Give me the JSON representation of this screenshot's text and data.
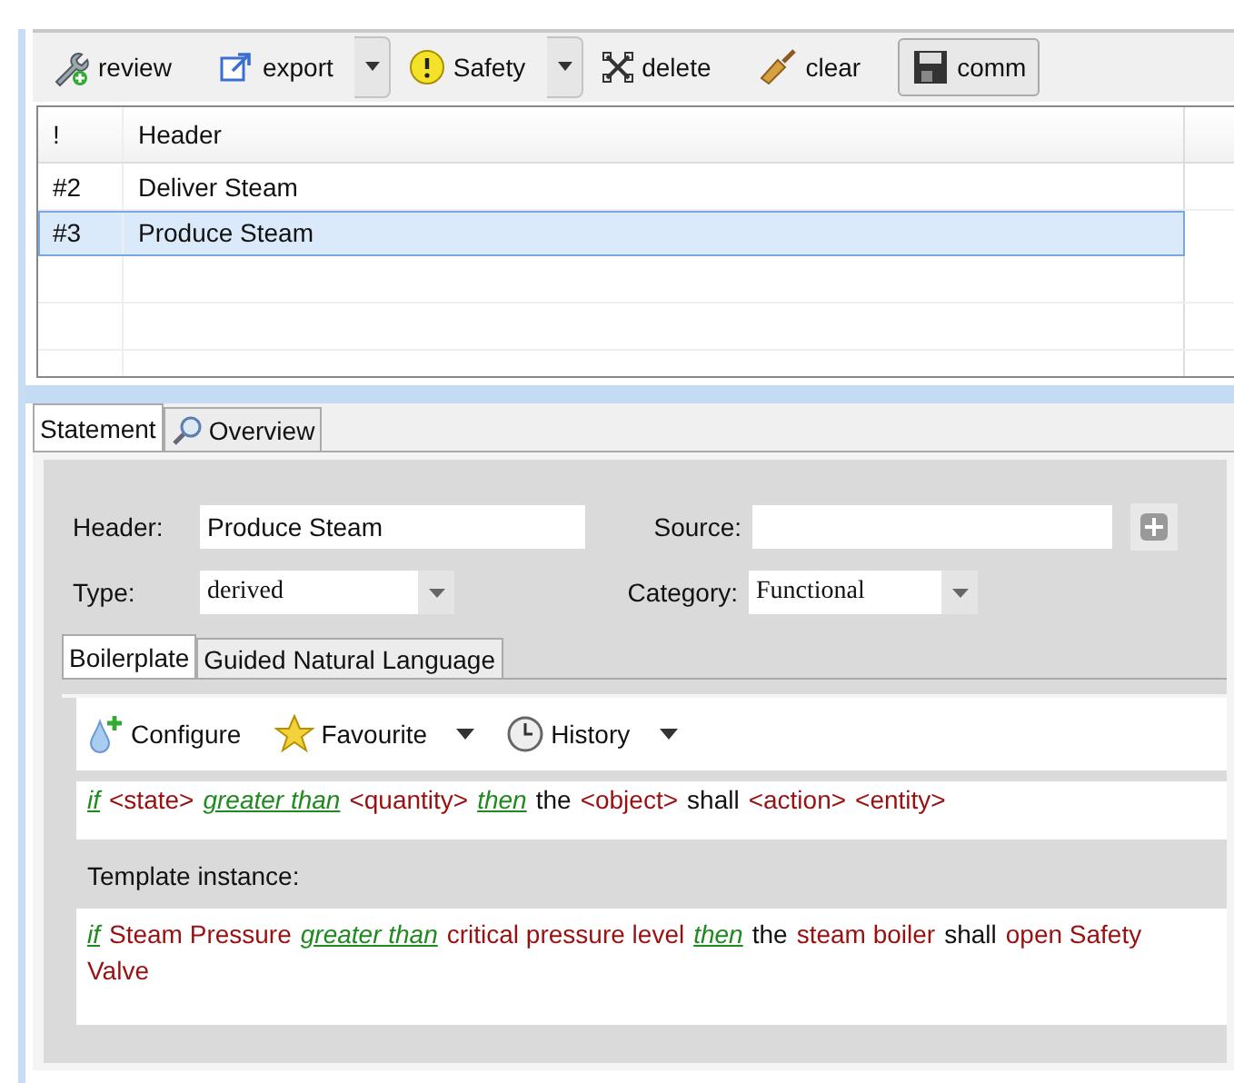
{
  "toolbar": [
    {
      "kind": "button",
      "label": "review"
    },
    {
      "kind": "button",
      "label": "export"
    },
    {
      "kind": "dropdown"
    },
    {
      "kind": "button",
      "label": "Safety"
    },
    {
      "kind": "dropdown"
    },
    {
      "kind": "button",
      "label": "delete"
    },
    {
      "kind": "button",
      "label": "clear"
    },
    {
      "kind": "framed",
      "label": "comm"
    }
  ],
  "table": {
    "columns": [
      "!",
      "Header"
    ],
    "rows": [
      {
        "id": "#2",
        "header": "Deliver Steam",
        "selected": false
      },
      {
        "id": "#3",
        "header": "Produce Steam",
        "selected": true
      }
    ]
  },
  "tabs": [
    {
      "label": "Statement",
      "selected": true
    },
    {
      "label": "Overview",
      "selected": false
    }
  ],
  "form": {
    "header_label": "Header:",
    "header_value": "Produce Steam",
    "source_label": "Source:",
    "type_label": "Type:",
    "type_value": "derived",
    "category_label": "Category:",
    "category_value": "Functional"
  },
  "inner_tabs": [
    {
      "label": "Boilerplate",
      "selected": true
    },
    {
      "label": "Guided Natural Language",
      "selected": false
    }
  ],
  "boilerplate_toolbar": [
    {
      "label": "Configure"
    },
    {
      "label": "Favourite"
    },
    {
      "label": "History"
    }
  ],
  "template": [
    {
      "kind": "keyword",
      "text": "if"
    },
    {
      "kind": "slot",
      "text": "<state>"
    },
    {
      "kind": "keyword",
      "text": "greater than"
    },
    {
      "kind": "slot",
      "text": "<quantity>"
    },
    {
      "kind": "keyword",
      "text": "then"
    },
    {
      "kind": "plain",
      "text": "the"
    },
    {
      "kind": "slot",
      "text": "<object>"
    },
    {
      "kind": "plain",
      "text": "shall"
    },
    {
      "kind": "slot",
      "text": "<action>"
    },
    {
      "kind": "slot",
      "text": "<entity>"
    }
  ],
  "instance_label": "Template instance:",
  "instance": [
    {
      "kind": "keyword",
      "text": "if"
    },
    {
      "kind": "slot",
      "text": "Steam Pressure"
    },
    {
      "kind": "keyword",
      "text": "greater than"
    },
    {
      "kind": "slot",
      "text": "critical pressure level"
    },
    {
      "kind": "keyword",
      "text": "then"
    },
    {
      "kind": "plain",
      "text": "the"
    },
    {
      "kind": "slot",
      "text": "steam boiler"
    },
    {
      "kind": "plain",
      "text": "shall"
    },
    {
      "kind": "slot",
      "text": "open Safety Valve"
    }
  ]
}
